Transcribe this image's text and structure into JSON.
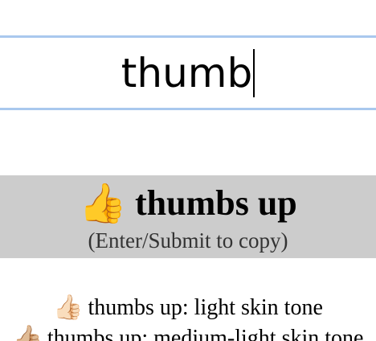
{
  "search": {
    "value": "thumb"
  },
  "selected": {
    "emoji": "👍",
    "name": "thumbs up",
    "hint": "(Enter/Submit to copy)"
  },
  "results": [
    {
      "emoji": "👍🏻",
      "name": "thumbs up: light skin tone"
    },
    {
      "emoji": "👍🏼",
      "name": "thumbs up: medium-light skin tone"
    }
  ],
  "colors": {
    "search_border": "#a9c8ee",
    "selected_background": "#cccccc"
  }
}
